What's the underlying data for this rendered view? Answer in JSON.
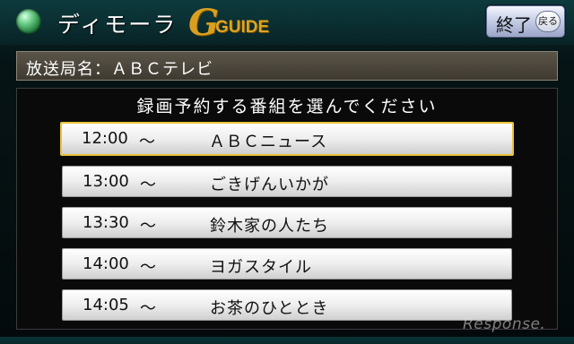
{
  "header": {
    "title": "ディモーラ",
    "logo_g": "G",
    "logo_text": "GUIDE",
    "end_button": "終了",
    "back_button": "戻る"
  },
  "station": {
    "label": "放送局名：ＡＢＣテレビ"
  },
  "prompt": "録画予約する番組を選んでください",
  "programs": [
    {
      "time": "12:00",
      "tilde": "～",
      "title": "ＡＢＣニュース",
      "selected": true
    },
    {
      "time": "13:00",
      "tilde": "～",
      "title": "ごきげんいかが",
      "selected": false
    },
    {
      "time": "13:30",
      "tilde": "～",
      "title": "鈴木家の人たち",
      "selected": false
    },
    {
      "time": "14:00",
      "tilde": "～",
      "title": "ヨガスタイル",
      "selected": false
    },
    {
      "time": "14:05",
      "tilde": "～",
      "title": "お茶のひととき",
      "selected": false
    }
  ],
  "watermark": "Response.",
  "colors": {
    "selection_border": "#e8c23a",
    "logo": "#d9a01e"
  }
}
